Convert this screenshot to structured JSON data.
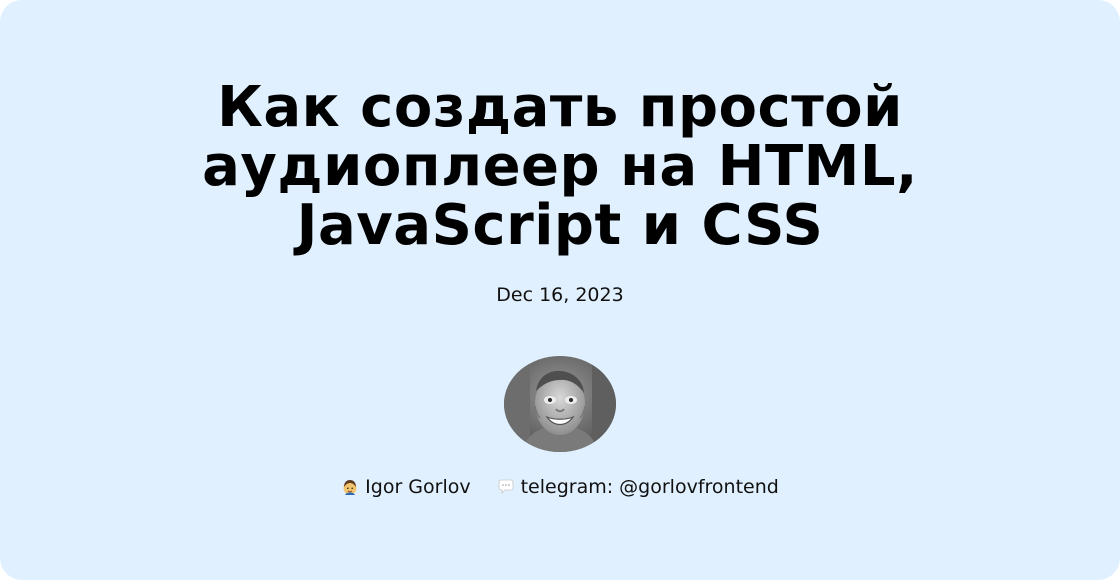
{
  "post": {
    "title_lines": [
      "Как создать простой",
      "аудиоплеер на HTML,",
      "JavaScript и CSS"
    ],
    "date": "Dec 16, 2023"
  },
  "author": {
    "avatar_icon": "author-photo",
    "name_icon": "man-emoji-icon",
    "name": "Igor Gorlov",
    "contact_icon": "speech-bubble-icon",
    "contact": "telegram: @gorlovfrontend"
  },
  "colors": {
    "background": "#e0f0fe",
    "text": "#000000"
  }
}
